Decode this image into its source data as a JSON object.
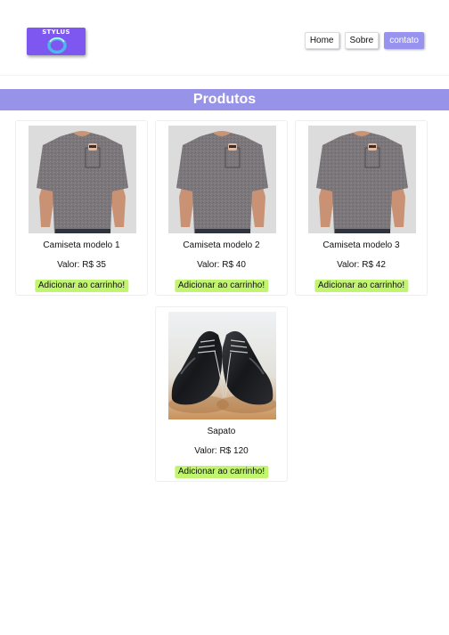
{
  "brand": {
    "logo_text": "STYLUS",
    "accent": "#7d57f0"
  },
  "nav": {
    "items": [
      "Home",
      "Sobre",
      "contato"
    ],
    "active_index": 2,
    "active_color": "#9793ee"
  },
  "section": {
    "title": "Produtos",
    "color": "#9693e9"
  },
  "products": [
    {
      "name": "Camiseta modelo 1",
      "price": "Valor: R$ 35",
      "button": "Adicionar ao carrinho!",
      "image": "tshirt"
    },
    {
      "name": "Camiseta modelo 2",
      "price": "Valor: R$ 40",
      "button": "Adicionar ao carrinho!",
      "image": "tshirt"
    },
    {
      "name": "Camiseta modelo 3",
      "price": "Valor: R$ 42",
      "button": "Adicionar ao carrinho!",
      "image": "tshirt"
    },
    {
      "name": "Sapato",
      "price": "Valor: R$ 120",
      "button": "Adicionar ao carrinho!",
      "image": "shoes"
    }
  ],
  "button_color": "#c2f56f"
}
